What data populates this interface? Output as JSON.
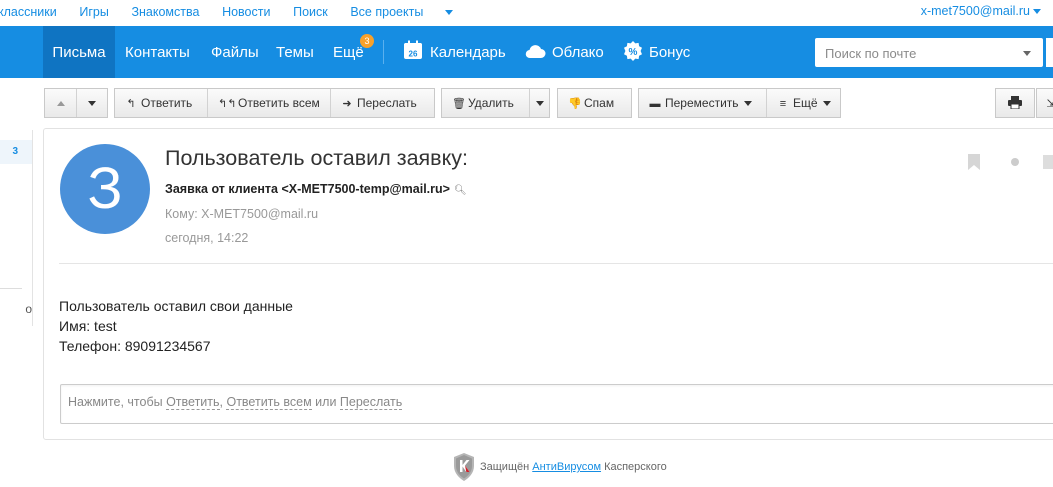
{
  "portal": {
    "links": [
      "классники",
      "Игры",
      "Знакомства",
      "Новости",
      "Поиск",
      "Все проекты"
    ],
    "user": "x-met7500@mail.ru"
  },
  "nav": {
    "items": [
      "Письма",
      "Контакты",
      "Файлы",
      "Темы",
      "Ещё"
    ],
    "more_badge": "3",
    "calendar_label": "Календарь",
    "calendar_day": "26",
    "cloud_label": "Облако",
    "bonus_label": "Бонус",
    "search_placeholder": "Поиск по почте"
  },
  "toolbar": {
    "reply": "Ответить",
    "reply_all": "Ответить всем",
    "forward": "Переслать",
    "delete": "Удалить",
    "spam": "Спам",
    "move": "Переместить",
    "more": "Ещё"
  },
  "sidebar": {
    "count": "3",
    "fragment": "о"
  },
  "message": {
    "avatar_letter": "З",
    "subject": "Пользователь оставил заявку:",
    "from": "Заявка от клиента <X-MET7500-temp@mail.ru>",
    "to": "Кому: X-MET7500@mail.ru",
    "date": "сегодня, 14:22",
    "body_lines": [
      "Пользователь оставил свои данные",
      "Имя: test",
      "Телефон: 89091234567"
    ]
  },
  "quick_reply": {
    "prefix": "Нажмите, чтобы",
    "reply": "Ответить",
    "sep": ",",
    "reply_all": "Ответить всем",
    "or": "или",
    "forward": "Переслать"
  },
  "footer": {
    "protected": "Защищён",
    "antivirus": "АнтиВирусом",
    "brand": "Касперского"
  },
  "colors": {
    "brand_blue": "#168de2",
    "active_tab": "#0f74c2",
    "badge": "#f7a12b",
    "avatar": "#4a90d9"
  }
}
